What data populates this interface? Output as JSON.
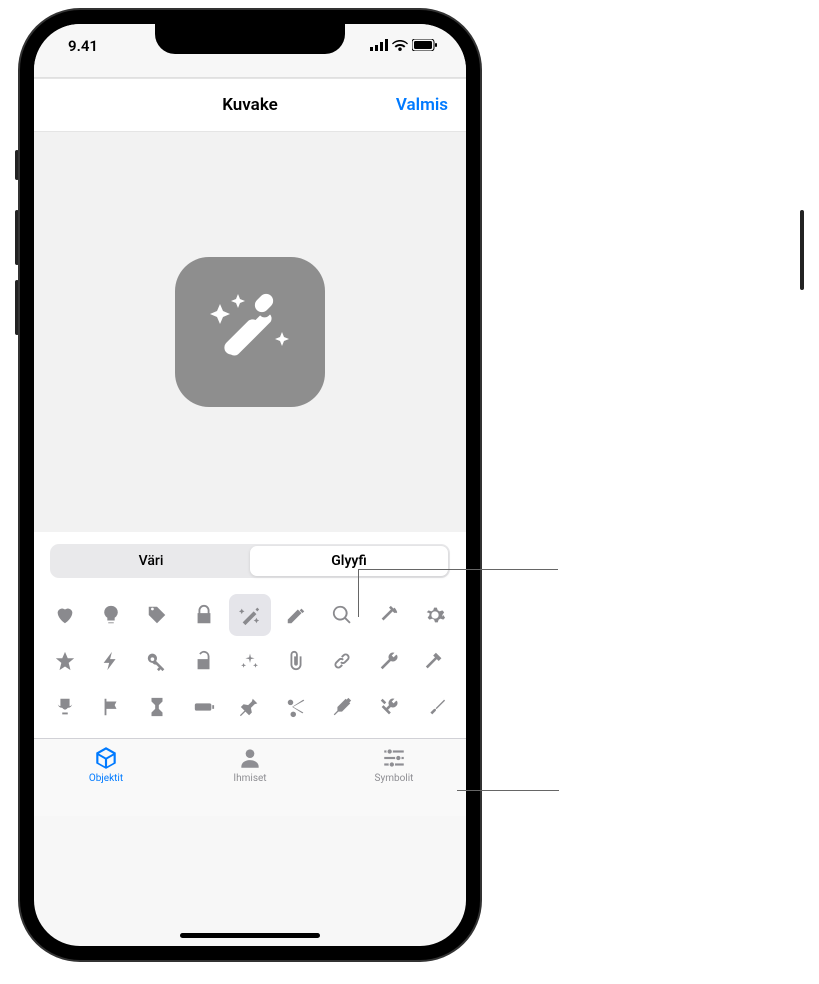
{
  "status": {
    "time": "9.41"
  },
  "nav": {
    "title": "Kuvake",
    "done": "Valmis"
  },
  "segments": {
    "color": "Väri",
    "glyph": "Glyyfi",
    "active": "glyph"
  },
  "glyph_names": [
    [
      "heart",
      "lightbulb",
      "tag",
      "lock",
      "wand",
      "pencil",
      "magnifier",
      "pickaxe",
      "gear"
    ],
    [
      "star",
      "bolt",
      "key",
      "unlock",
      "sparkle",
      "paperclip",
      "link",
      "wrench",
      "hammer"
    ],
    [
      "trophy",
      "flag",
      "hourglass",
      "battery",
      "pin",
      "scissors",
      "eyedropper",
      "tools",
      "screwdriver"
    ]
  ],
  "selected_glyph": "wand",
  "tabs": {
    "objects": "Objektit",
    "people": "Ihmiset",
    "symbols": "Symbolit",
    "active": "objects"
  }
}
